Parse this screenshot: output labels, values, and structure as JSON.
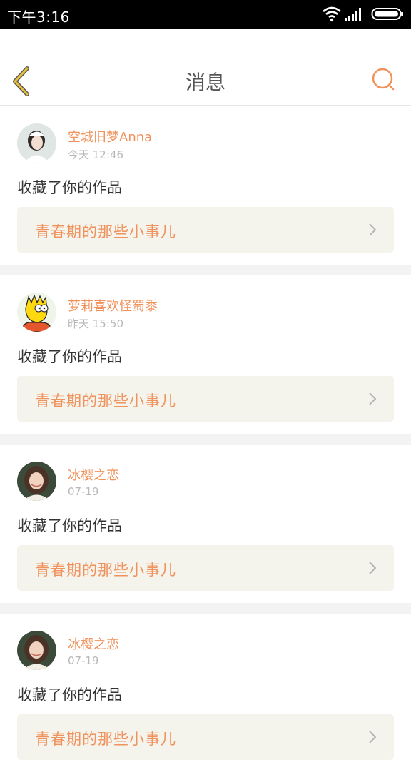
{
  "status_bar": {
    "time": "下午3:16",
    "battery_icon": "battery-icon",
    "signal_icon": "cellular-signal-icon",
    "wifi_icon": "wifi-icon"
  },
  "header": {
    "title": "消息",
    "back_icon": "chevron-left-icon",
    "search_icon": "search-icon"
  },
  "colors": {
    "accent": "#f0925c",
    "card_bg": "#f4f3ec",
    "separator": "#f3f3f3",
    "back_arrow": "#e6bf3a"
  },
  "messages": [
    {
      "user": "空城旧梦Anna",
      "time": "今天 12:46",
      "action": "收藏了你的作品",
      "work_title": "青春期的那些小事儿"
    },
    {
      "user": "萝莉喜欢怪蜀黍",
      "time": "昨天 15:50",
      "action": "收藏了你的作品",
      "work_title": "青春期的那些小事儿"
    },
    {
      "user": "冰樱之恋",
      "time": "07-19",
      "action": "收藏了你的作品",
      "work_title": "青春期的那些小事儿"
    },
    {
      "user": "冰樱之恋",
      "time": "07-19",
      "action": "收藏了你的作品",
      "work_title": "青春期的那些小事儿"
    }
  ]
}
